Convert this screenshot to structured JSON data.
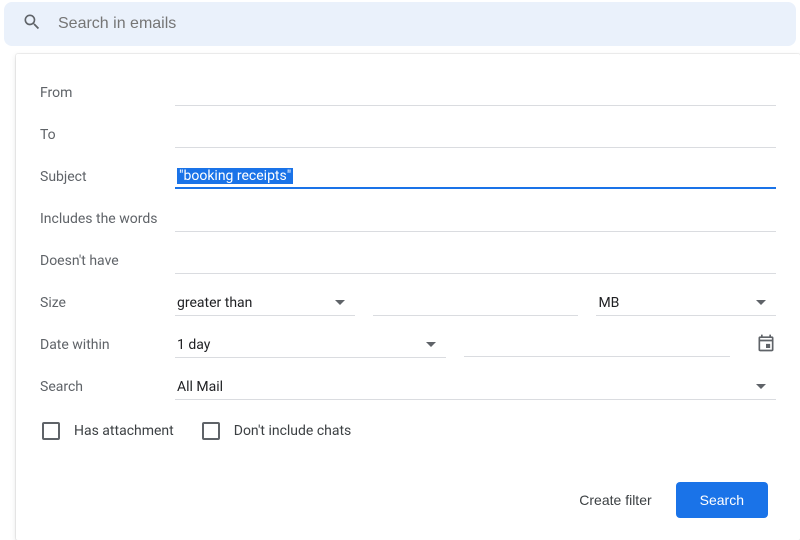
{
  "searchbar": {
    "placeholder": "Search in emails"
  },
  "labels": {
    "from": "From",
    "to": "To",
    "subject": "Subject",
    "includes": "Includes the words",
    "doesnt_have": "Doesn't have",
    "size": "Size",
    "date_within": "Date within",
    "search": "Search"
  },
  "values": {
    "from": "",
    "to": "",
    "subject": "\"booking receipts\"",
    "includes": "",
    "doesnt_have": "",
    "size_op": "greater than",
    "size_value": "",
    "size_unit": "MB",
    "date_within": "1 day",
    "date_value": "",
    "search_in": "All Mail"
  },
  "checkboxes": {
    "has_attachment": "Has attachment",
    "dont_include_chats": "Don't include chats"
  },
  "actions": {
    "create_filter": "Create filter",
    "search": "Search"
  }
}
